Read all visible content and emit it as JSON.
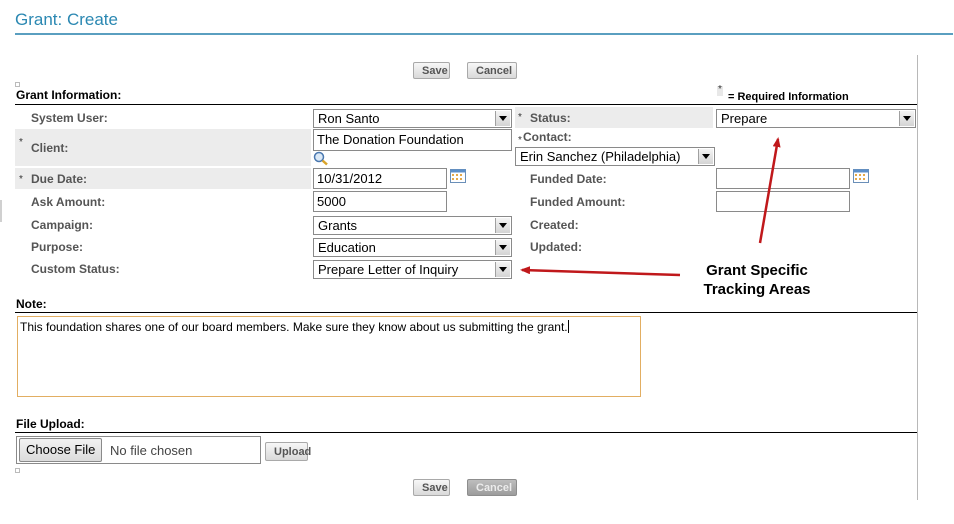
{
  "page": {
    "title": "Grant: Create"
  },
  "buttons": {
    "save": "Save",
    "cancel": "Cancel",
    "upload": "Upload"
  },
  "required_note": {
    "mark": "*",
    "text": "= Required Information"
  },
  "grant_info": {
    "heading": "Grant Information:",
    "left": {
      "system_user": {
        "label": "System User:",
        "value": "Ron Santo"
      },
      "client": {
        "mark": "*",
        "label": "Client:",
        "value": "The Donation Foundation"
      },
      "due_date": {
        "mark": "*",
        "label": "Due Date:",
        "value": "10/31/2012"
      },
      "ask_amount": {
        "label": "Ask Amount:",
        "value": "5000"
      },
      "campaign": {
        "label": "Campaign:",
        "value": "Grants"
      },
      "purpose": {
        "label": "Purpose:",
        "value": "Education"
      },
      "custom_status": {
        "label": "Custom Status:",
        "value": "Prepare Letter of Inquiry"
      }
    },
    "right": {
      "status": {
        "mark": "*",
        "label": "Status:",
        "value": "Prepare"
      },
      "contact": {
        "mark": "*",
        "label": "Contact:",
        "value": "Erin Sanchez (Philadelphia)"
      },
      "funded_date": {
        "label": "Funded Date:",
        "value": ""
      },
      "funded_amount": {
        "label": "Funded Amount:",
        "value": ""
      },
      "created": {
        "label": "Created:"
      },
      "updated": {
        "label": "Updated:"
      }
    }
  },
  "note": {
    "heading": "Note:",
    "value": "This foundation shares one of our board members.  Make sure they know about us submitting the grant."
  },
  "file_upload": {
    "heading": "File Upload:",
    "choose_label": "Choose File",
    "status": "No file chosen"
  },
  "annotation": {
    "line1": "Grant Specific",
    "line2": "Tracking Areas",
    "arrow_color": "#c0181b"
  },
  "colors": {
    "title": "#2b88b2",
    "row_highlight": "#ececec",
    "note_border": "#e2ae62"
  }
}
